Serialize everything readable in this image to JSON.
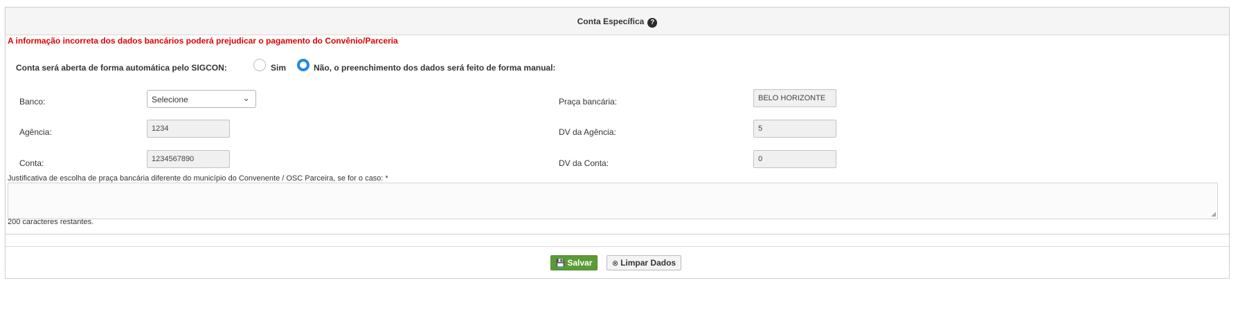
{
  "header": {
    "title": "Conta Específica",
    "help_icon": "?"
  },
  "warning": "A informação incorreta dos dados bancários poderá prejudicar o pagamento do Convênio/Parceria",
  "auto_account": {
    "label": "Conta será aberta de forma automática pelo SIGCON:",
    "options": [
      {
        "label": "Sim",
        "selected": false
      },
      {
        "label": "Não, o preenchimento dos dados será feito de forma manual:",
        "selected": true
      }
    ]
  },
  "fields": {
    "banco": {
      "label": "Banco:",
      "value": "Selecione"
    },
    "praca": {
      "label": "Praça bancária:",
      "value": "BELO HORIZONTE"
    },
    "agencia": {
      "label": "Agência:",
      "value": "1234"
    },
    "dv_agencia": {
      "label": "DV da Agência:",
      "value": "5"
    },
    "conta": {
      "label": "Conta:",
      "value": "1234567890"
    },
    "dv_conta": {
      "label": "DV da Conta:",
      "value": "0"
    }
  },
  "justificativa": {
    "label": "Justificativa de escolha de praça bancária diferente do município do Convenente / OSC Parceira, se for o caso: *",
    "value": "",
    "remaining": "200 caracteres restantes."
  },
  "buttons": {
    "save": "Salvar",
    "clear": "Limpar Dados"
  },
  "colors": {
    "warning": "#e00000",
    "save_button": "#5b9b35",
    "radio_selected": "#1e88e5"
  }
}
